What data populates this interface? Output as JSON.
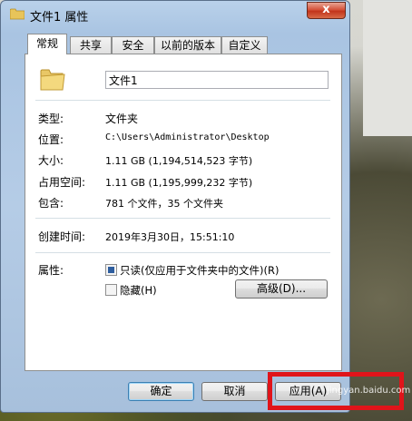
{
  "window": {
    "title": "文件1 属性",
    "close_label": "x"
  },
  "tabs": [
    {
      "label": "常规",
      "active": true
    },
    {
      "label": "共享",
      "active": false
    },
    {
      "label": "安全",
      "active": false
    },
    {
      "label": "以前的版本",
      "active": false
    },
    {
      "label": "自定义",
      "active": false
    }
  ],
  "general": {
    "name_value": "文件1",
    "rows": [
      {
        "label": "类型:",
        "value": "文件夹"
      },
      {
        "label": "位置:",
        "value": "C:\\Users\\Administrator\\Desktop"
      },
      {
        "label": "大小:",
        "value": "1.11 GB (1,194,514,523 字节)"
      },
      {
        "label": "占用空间:",
        "value": "1.11 GB (1,195,999,232 字节)"
      },
      {
        "label": "包含:",
        "value": "781 个文件，35 个文件夹"
      }
    ],
    "created_label": "创建时间:",
    "created_value": "2019年3月30日，15:51:10",
    "attributes_label": "属性:",
    "readonly_label": "只读(仅应用于文件夹中的文件)(R)",
    "hidden_label": "隐藏(H)",
    "advanced_button": "高级(D)..."
  },
  "footer": {
    "ok_button": "确定",
    "cancel_button": "取消",
    "apply_button": "应用(A)"
  },
  "watermark": "jingyan.baidu.com"
}
